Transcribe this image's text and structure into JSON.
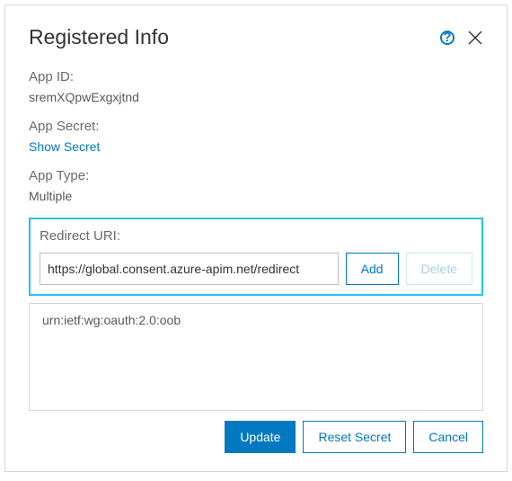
{
  "header": {
    "title": "Registered Info"
  },
  "fields": {
    "app_id_label": "App ID:",
    "app_id_value": "sremXQpwExgxjtnd",
    "app_secret_label": "App Secret:",
    "show_secret_link": "Show Secret",
    "app_type_label": "App Type:",
    "app_type_value": "Multiple",
    "redirect_label": "Redirect URI:",
    "redirect_value": "https://global.consent.azure-apim.net/redirect"
  },
  "buttons": {
    "add": "Add",
    "delete": "Delete",
    "update": "Update",
    "reset_secret": "Reset Secret",
    "cancel": "Cancel"
  },
  "redirect_list": {
    "items": [
      "urn:ietf:wg:oauth:2.0:oob"
    ]
  },
  "icons": {
    "help": "?",
    "close": "close"
  }
}
